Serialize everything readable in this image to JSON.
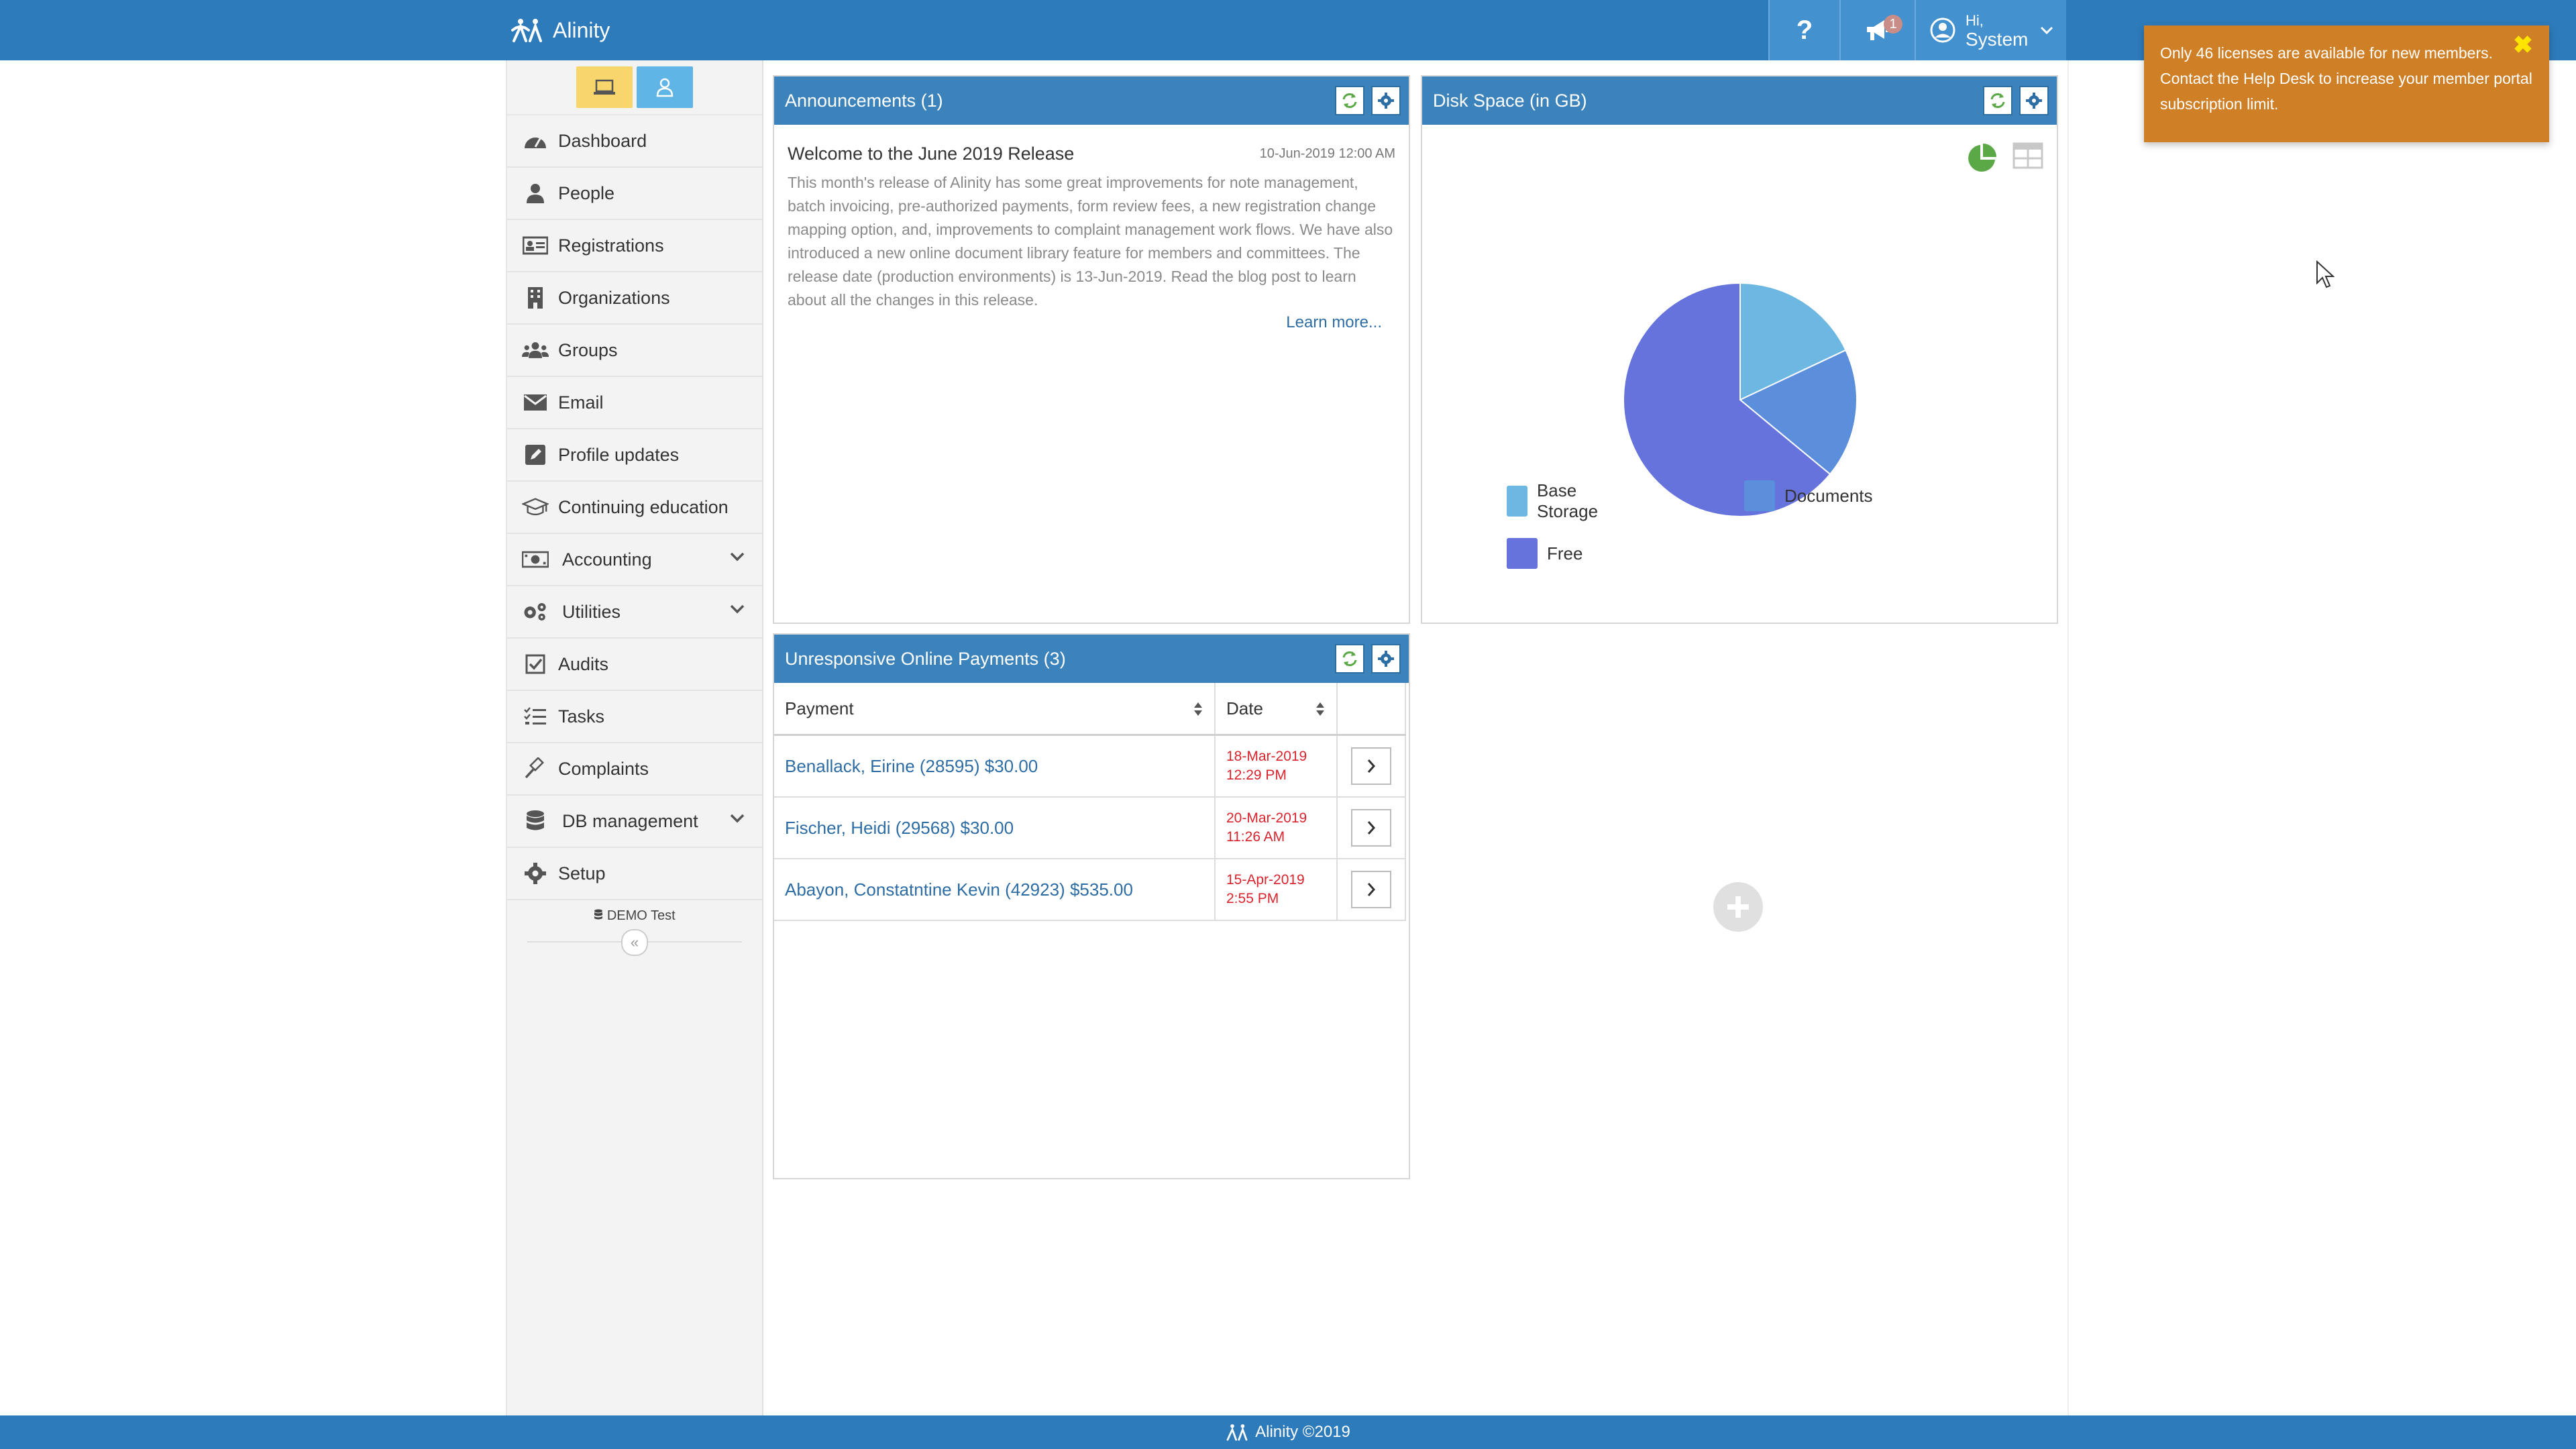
{
  "app": {
    "name": "Alinity"
  },
  "header": {
    "help_label": "?",
    "announcement_badge": "1",
    "user_greeting": "Hi,",
    "user_name": "System"
  },
  "sidebar": {
    "items": [
      {
        "label": "Dashboard",
        "icon": "dashboard-icon"
      },
      {
        "label": "People",
        "icon": "person-icon"
      },
      {
        "label": "Registrations",
        "icon": "id-card-icon"
      },
      {
        "label": "Organizations",
        "icon": "building-icon"
      },
      {
        "label": "Groups",
        "icon": "users-icon"
      },
      {
        "label": "Email",
        "icon": "envelope-icon"
      },
      {
        "label": "Profile updates",
        "icon": "edit-icon"
      },
      {
        "label": "Continuing education",
        "icon": "graduation-cap-icon"
      },
      {
        "label": "Accounting",
        "icon": "money-icon"
      },
      {
        "label": "Utilities",
        "icon": "gears-icon"
      },
      {
        "label": "Audits",
        "icon": "checkbox-icon"
      },
      {
        "label": "Tasks",
        "icon": "tasks-icon"
      },
      {
        "label": "Complaints",
        "icon": "gavel-icon"
      },
      {
        "label": "DB management",
        "icon": "database-icon"
      },
      {
        "label": "Setup",
        "icon": "gear-icon"
      }
    ],
    "db_label": "DEMO Test",
    "collapse_label": "«"
  },
  "announcements": {
    "title": "Announcements (1)",
    "item_title": "Welcome to the June 2019 Release",
    "item_date": "10-Jun-2019 12:00 AM",
    "item_body": "This month's release of Alinity has some great improvements for note management, batch invoicing, pre-authorized payments, form review fees, a new registration change mapping option, and, improvements to complaint management work flows. We have also introduced a new online document library feature for members and committees. The release date (production environments) is 13-Jun-2019. Read the blog post to learn about all the changes in this release.",
    "learn_more": "Learn more..."
  },
  "disk_space": {
    "title": "Disk Space (in GB)"
  },
  "chart_data": {
    "type": "pie",
    "title": "Disk Space (in GB)",
    "legend_position": "bottom",
    "slices": [
      {
        "name": "Base Storage",
        "value": 18,
        "color": "#6cb8e2"
      },
      {
        "name": "Documents",
        "value": 18,
        "color": "#5b8fdb"
      },
      {
        "name": "Free",
        "value": 64,
        "color": "#6673dd"
      }
    ]
  },
  "payments": {
    "title": "Unresponsive Online Payments (3)",
    "columns": [
      "Payment",
      "Date"
    ],
    "rows": [
      {
        "payment": "Benallack, Eirine (28595) $30.00",
        "date1": "18-Mar-2019",
        "date2": "12:29 PM"
      },
      {
        "payment": "Fischer, Heidi (29568) $30.00",
        "date1": "20-Mar-2019",
        "date2": "11:26 AM"
      },
      {
        "payment": "Abayon, Constatntine Kevin (42923) $535.00",
        "date1": "15-Apr-2019",
        "date2": "2:55 PM"
      }
    ]
  },
  "toast": {
    "message": "Only 46 licenses are available for new members. Contact the Help Desk to increase your member portal subscription limit.",
    "close": "✖"
  },
  "footer": {
    "text": "Alinity ©2019"
  },
  "colors": {
    "brand": "#2e7bbb",
    "toast": "#cf7f26",
    "date_red": "#d9232d"
  }
}
